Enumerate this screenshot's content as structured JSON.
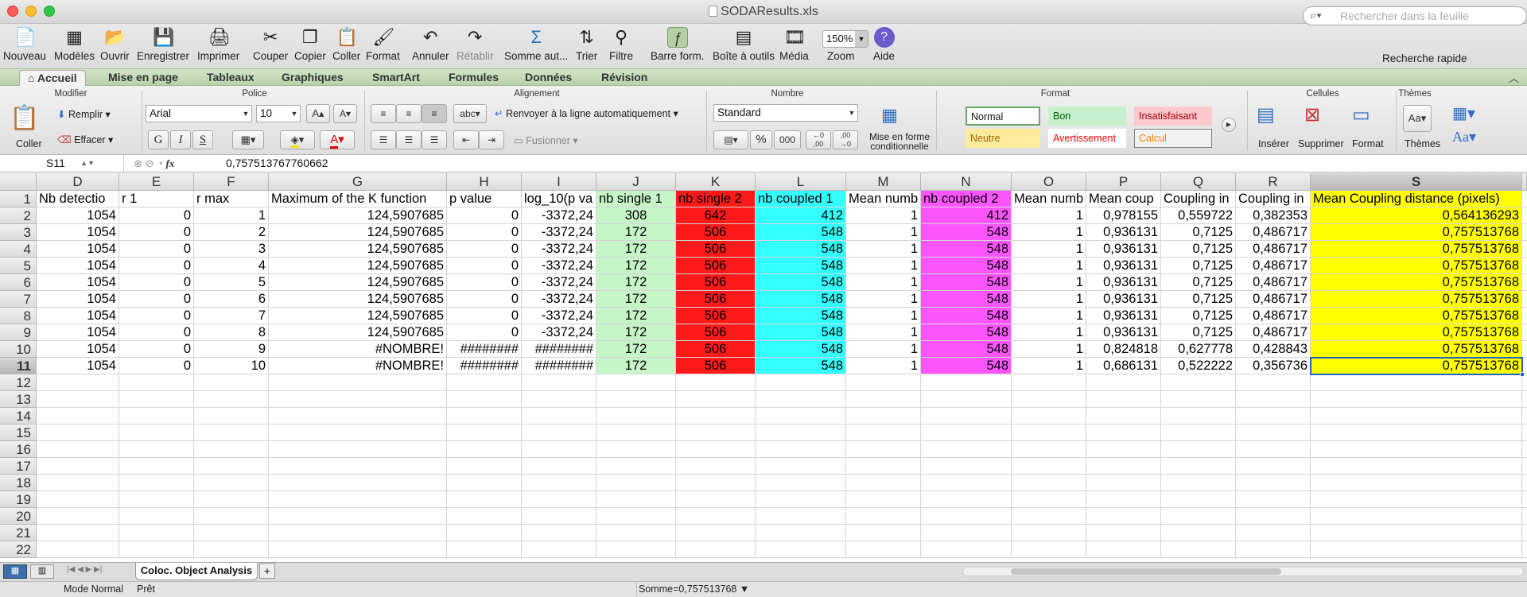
{
  "window": {
    "title": "SODAResults.xls"
  },
  "toolbar": {
    "items": [
      "Nouveau",
      "Modèles",
      "Ouvrir",
      "Enregistrer",
      "Imprimer",
      "Couper",
      "Copier",
      "Coller",
      "Format",
      "Annuler",
      "Rétablir",
      "Somme aut...",
      "Trier",
      "Filtre",
      "Barre form.",
      "Boîte à outils",
      "Média",
      "Zoom",
      "Aide"
    ],
    "zoom": "150%",
    "search_placeholder": "Rechercher dans la feuille",
    "search_label": "Recherche rapide"
  },
  "ribbon_tabs": [
    "Accueil",
    "Mise en page",
    "Tableaux",
    "Graphiques",
    "SmartArt",
    "Formules",
    "Données",
    "Révision"
  ],
  "ribbon": {
    "groups": [
      "Modifier",
      "Police",
      "Alignement",
      "Nombre",
      "Format",
      "Cellules",
      "Thèmes"
    ],
    "coller": "Coller",
    "remplir": "Remplir",
    "effacer": "Effacer",
    "font": "Arial",
    "size": "10",
    "wrap": "Renvoyer à la ligne automatiquement",
    "merge": "Fusionner",
    "numfmt": "Standard",
    "cond": "Mise en forme conditionnelle",
    "styles": [
      "Normal",
      "Bon",
      "Insatisfaisant",
      "Neutre",
      "Avertissement",
      "Calcul"
    ],
    "cells": [
      "Insérer",
      "Supprimer",
      "Format"
    ],
    "themes": "Thèmes",
    "abc": "abc"
  },
  "formula_bar": {
    "name": "S11",
    "fx": "fx",
    "value": "0,757513767760662"
  },
  "columns": [
    "D",
    "E",
    "F",
    "G",
    "H",
    "I",
    "J",
    "K",
    "L",
    "M",
    "N",
    "O",
    "P",
    "Q",
    "R",
    "S"
  ],
  "header_row": [
    "Nb detectio",
    "r 1",
    "r max",
    "Maximum of the K function",
    "p value",
    "log_10(p va",
    "nb single 1",
    "nb single 2",
    "nb coupled 1",
    "Mean numb",
    "nb coupled 2",
    "Mean numb",
    "Mean coup",
    "Coupling in",
    "Coupling in",
    "Mean Coupling distance (pixels)"
  ],
  "rows": [
    [
      "1054",
      "0",
      "1",
      "124,5907685",
      "0",
      "-3372,24",
      "308",
      "642",
      "412",
      "1",
      "412",
      "1",
      "0,978155",
      "0,559722",
      "0,382353",
      "0,564136293"
    ],
    [
      "1054",
      "0",
      "2",
      "124,5907685",
      "0",
      "-3372,24",
      "172",
      "506",
      "548",
      "1",
      "548",
      "1",
      "0,936131",
      "0,7125",
      "0,486717",
      "0,757513768"
    ],
    [
      "1054",
      "0",
      "3",
      "124,5907685",
      "0",
      "-3372,24",
      "172",
      "506",
      "548",
      "1",
      "548",
      "1",
      "0,936131",
      "0,7125",
      "0,486717",
      "0,757513768"
    ],
    [
      "1054",
      "0",
      "4",
      "124,5907685",
      "0",
      "-3372,24",
      "172",
      "506",
      "548",
      "1",
      "548",
      "1",
      "0,936131",
      "0,7125",
      "0,486717",
      "0,757513768"
    ],
    [
      "1054",
      "0",
      "5",
      "124,5907685",
      "0",
      "-3372,24",
      "172",
      "506",
      "548",
      "1",
      "548",
      "1",
      "0,936131",
      "0,7125",
      "0,486717",
      "0,757513768"
    ],
    [
      "1054",
      "0",
      "6",
      "124,5907685",
      "0",
      "-3372,24",
      "172",
      "506",
      "548",
      "1",
      "548",
      "1",
      "0,936131",
      "0,7125",
      "0,486717",
      "0,757513768"
    ],
    [
      "1054",
      "0",
      "7",
      "124,5907685",
      "0",
      "-3372,24",
      "172",
      "506",
      "548",
      "1",
      "548",
      "1",
      "0,936131",
      "0,7125",
      "0,486717",
      "0,757513768"
    ],
    [
      "1054",
      "0",
      "8",
      "124,5907685",
      "0",
      "-3372,24",
      "172",
      "506",
      "548",
      "1",
      "548",
      "1",
      "0,936131",
      "0,7125",
      "0,486717",
      "0,757513768"
    ],
    [
      "1054",
      "0",
      "9",
      "#NOMBRE!",
      "########",
      "########",
      "172",
      "506",
      "548",
      "1",
      "548",
      "1",
      "0,824818",
      "0,627778",
      "0,428843",
      "0,757513768"
    ],
    [
      "1054",
      "0",
      "10",
      "#NOMBRE!",
      "########",
      "########",
      "172",
      "506",
      "548",
      "1",
      "548",
      "1",
      "0,686131",
      "0,522222",
      "0,356736",
      "0,757513768"
    ]
  ],
  "row_numbers": [
    "1",
    "2",
    "3",
    "4",
    "5",
    "6",
    "7",
    "8",
    "9",
    "10",
    "11",
    "12",
    "13",
    "14",
    "15",
    "16",
    "17",
    "18",
    "19",
    "20",
    "21",
    "22"
  ],
  "column_colors": {
    "J": "#c6f5c8",
    "K": "#ff1a1a",
    "L": "#33ffff",
    "N": "#ff55ff",
    "S": "#ffff00"
  },
  "sheet": {
    "tab": "Coloc. Object Analysis",
    "add": "+"
  },
  "status": {
    "mode": "Mode Normal",
    "ready": "Prêt",
    "sum": "Somme=0,757513768"
  }
}
